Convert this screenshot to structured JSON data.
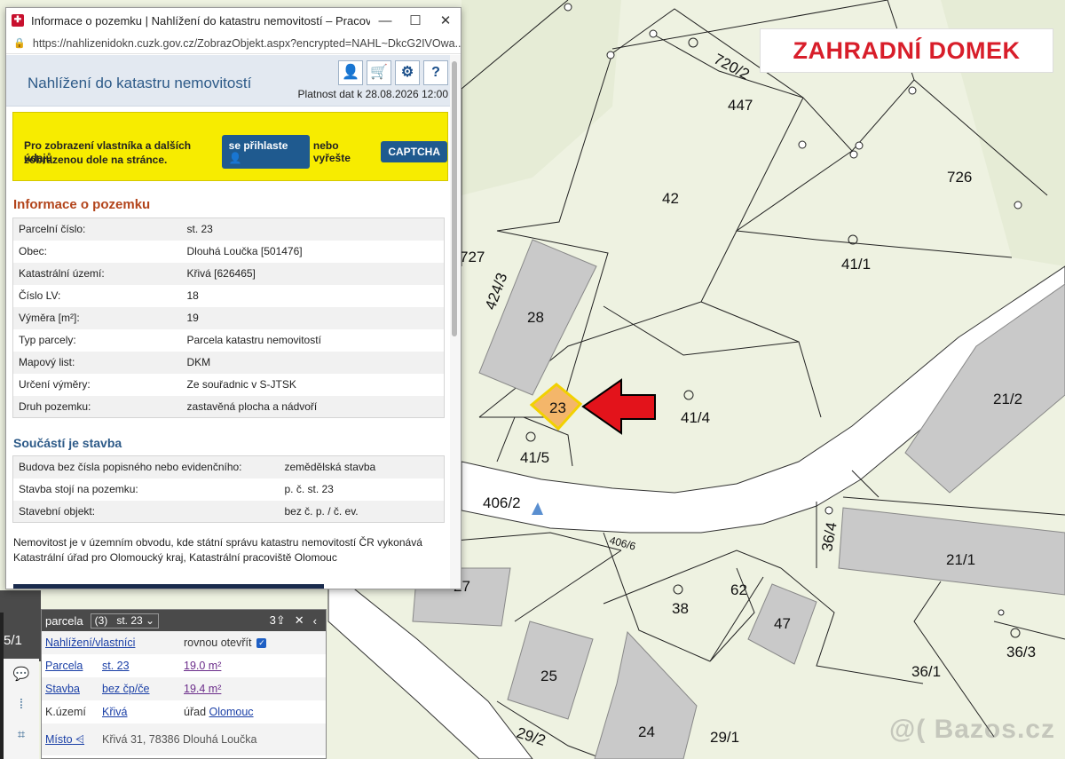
{
  "overlay_title": "ZAHRADNÍ DOMEK",
  "watermark": "@( Bazos.cz",
  "map": {
    "parcel_labels": [
      "720/2",
      "447",
      "726",
      "42",
      "41/1",
      "727",
      "424/3",
      "28",
      "23",
      "41/4",
      "21/2",
      "41/5",
      "406/2",
      "406/6",
      "36/4",
      "21/1",
      "27",
      "62",
      "38",
      "47",
      "36/3",
      "36/1",
      "25",
      "24",
      "29/2",
      "29/1",
      "5/1"
    ]
  },
  "browser": {
    "window_title": "Informace o pozemku | Nahlížení do katastru nemovitostí – Pracovní...",
    "url": "https://nahlizenidokn.cuzk.gov.cz/ZobrazObjekt.aspx?encrypted=NAHL~DkcG2IVOwa..."
  },
  "app": {
    "title": "Nahlížení do katastru nemovitostí",
    "validity": "Platnost dat k 28.08.2026 12:00",
    "icons": [
      "user-icon",
      "cart-icon",
      "gear-icon",
      "help-icon"
    ]
  },
  "notice": {
    "text1": "Pro zobrazení vlastníka a dalších údajů",
    "login_button": "se přihlaste",
    "text2": "nebo vyřešte",
    "captcha_button": "CAPTCHA",
    "text3": "zobrazenou dole na stránce."
  },
  "parcel_info": {
    "heading": "Informace o pozemku",
    "rows": [
      {
        "k": "Parcelní číslo:",
        "v": "st. 23"
      },
      {
        "k": "Obec:",
        "v": "Dlouhá Loučka [501476]"
      },
      {
        "k": "Katastrální území:",
        "v": "Křivá [626465]"
      },
      {
        "k": "Číslo LV:",
        "v": "18"
      },
      {
        "k": "Výměra [m²]:",
        "v": "19"
      },
      {
        "k": "Typ parcely:",
        "v": "Parcela katastru nemovitostí"
      },
      {
        "k": "Mapový list:",
        "v": "DKM"
      },
      {
        "k": "Určení výměry:",
        "v": "Ze souřadnic v S-JTSK"
      },
      {
        "k": "Druh pozemku:",
        "v": "zastavěná plocha a nádvoří"
      }
    ]
  },
  "building": {
    "heading": "Součástí je stavba",
    "rows": [
      {
        "k": "Budova bez čísla popisného nebo evidenčního:",
        "v": "zemědělská stavba"
      },
      {
        "k": "Stavba stojí na pozemku:",
        "v": "p. č. st. 23"
      },
      {
        "k": "Stavební objekt:",
        "v": "bez č. p. / č. ev."
      }
    ]
  },
  "footer_text": "Nemovitost je v územním obvodu, kde státní správu katastru nemovitostí ČR vykonává Katastrální úřad pro Olomoucký kraj, Katastrální pracoviště Olomouc",
  "panel": {
    "header": "parcela",
    "count": "(3)",
    "selected": "st. 23",
    "share_count": "3",
    "link_row": {
      "label": "Nahlížení/vlastníci",
      "value": "rovnou otevřít"
    },
    "parcela": {
      "label": "Parcela",
      "id": "st. 23",
      "area": "19.0 m²"
    },
    "stavba": {
      "label": "Stavba",
      "id": "bez čp/če",
      "area": "19.4 m²"
    },
    "kuzemi": {
      "label": "K.území",
      "name": "Křivá",
      "office_label": "úřad",
      "office": "Olomouc"
    },
    "misto": {
      "label": "Místo",
      "address": "Křivá 31, 78386 Dlouhá Loučka"
    }
  },
  "left_fragment": "5/1",
  "colors": {
    "accent_red": "#d81e2a",
    "map_bg": "#eef2e1",
    "road": "#ffffff",
    "building": "#c9c9c9",
    "highlight": "#f4b66a"
  }
}
